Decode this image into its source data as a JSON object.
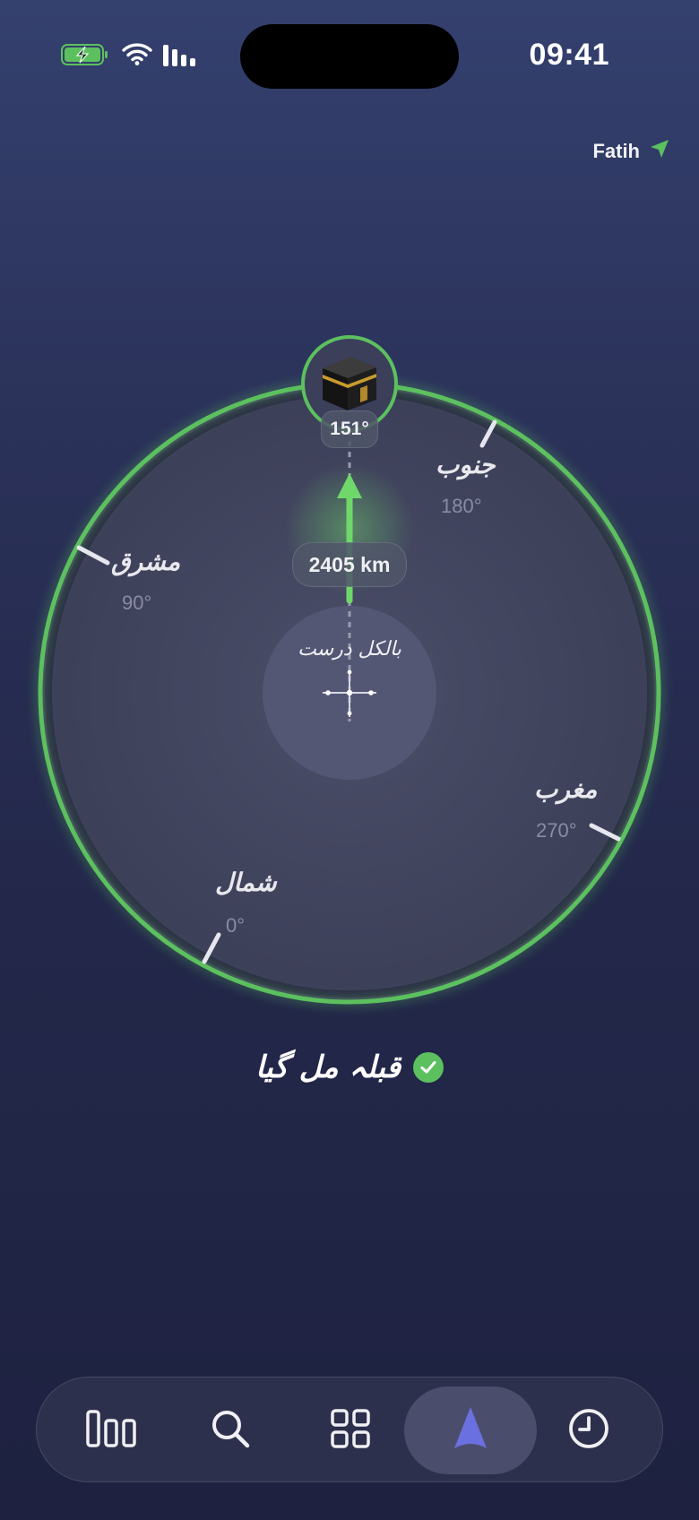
{
  "status_bar": {
    "time": "09:41"
  },
  "location": {
    "city": "Fatih"
  },
  "compass": {
    "qibla_bearing": "151°",
    "distance": "2405 km",
    "center_label": "بالکل درست",
    "directions": [
      {
        "name": "شمال",
        "degree": "0°"
      },
      {
        "name": "مشرق",
        "degree": "90°"
      },
      {
        "name": "جنوب",
        "degree": "180°"
      },
      {
        "name": "مغرب",
        "degree": "270°"
      }
    ],
    "ring_color": "#5cc05f"
  },
  "status": {
    "message": "قبلہ مل گیا"
  },
  "tabs": [
    {
      "icon": "stats-bars-icon",
      "active": false
    },
    {
      "icon": "search-icon",
      "active": false
    },
    {
      "icon": "grid-icon",
      "active": false
    },
    {
      "icon": "compass-arrow-icon",
      "active": true
    },
    {
      "icon": "clock-icon",
      "active": false
    }
  ]
}
